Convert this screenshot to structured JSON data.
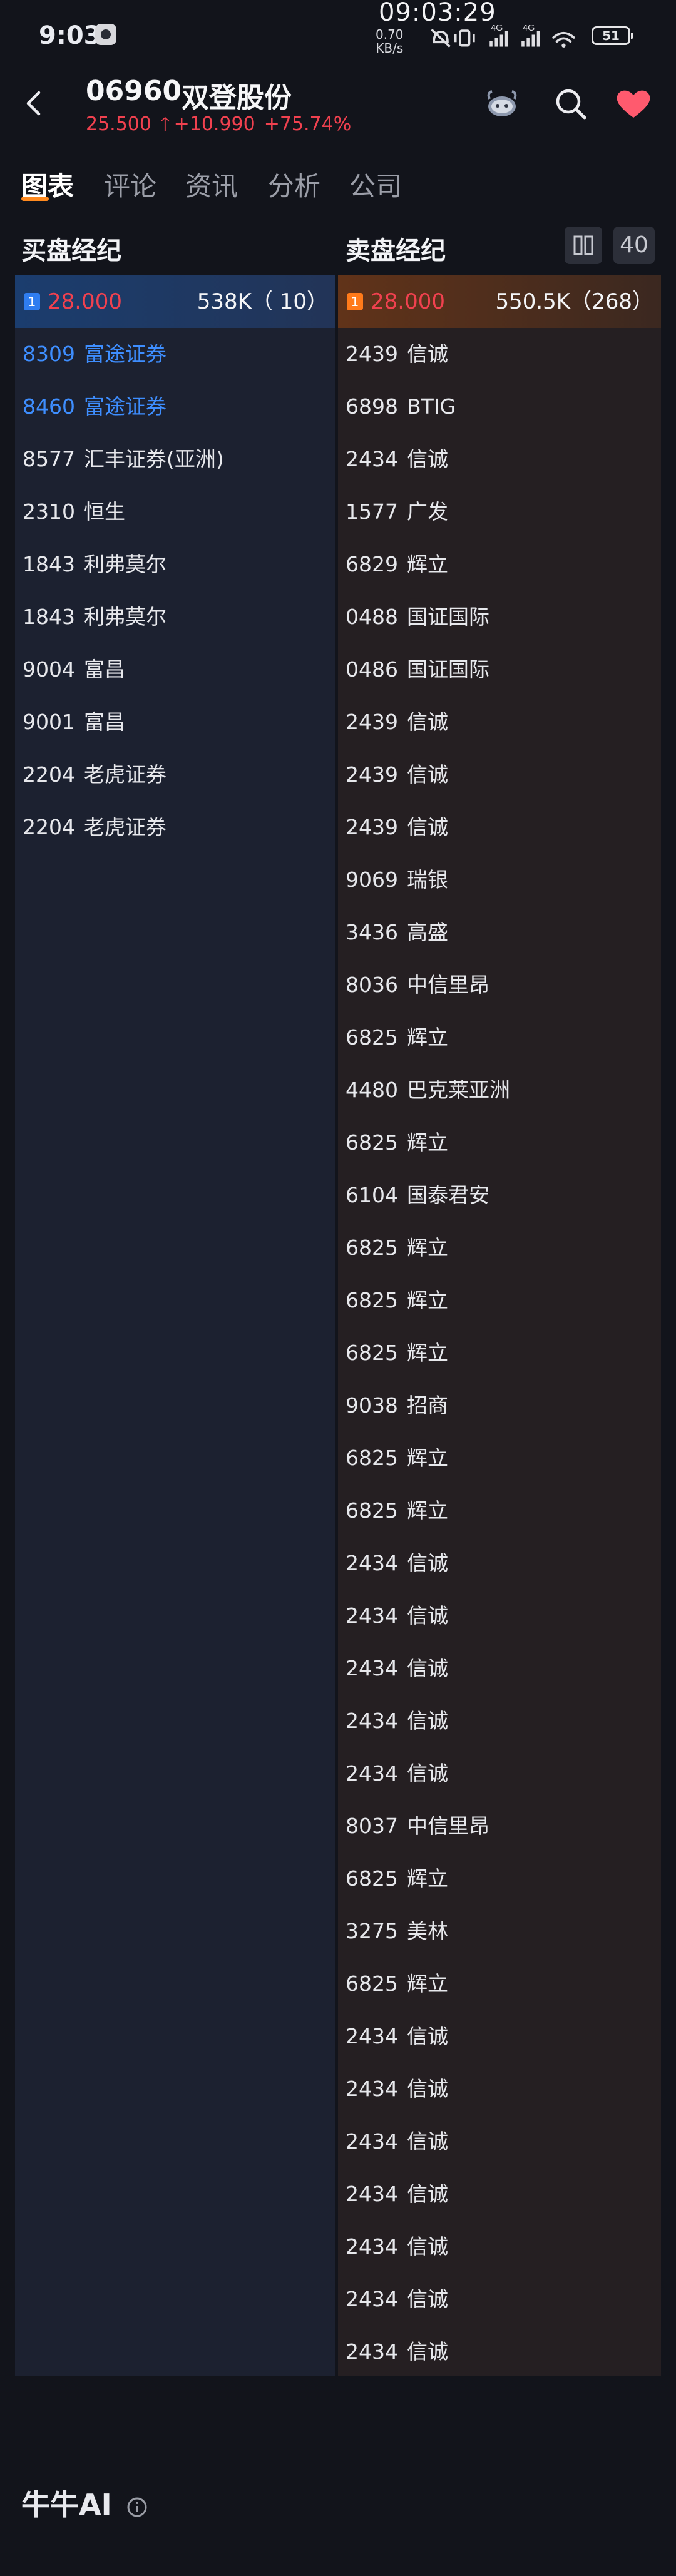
{
  "status_bar": {
    "time": "9:03",
    "clock_overlay": "09:03:29",
    "net_speed_value": "0.70",
    "net_speed_unit": "KB/s",
    "network_1": "4G",
    "network_2": "4G",
    "battery": "51"
  },
  "header": {
    "code": "06960",
    "name": "双登股份",
    "price": "25.500",
    "change": "+10.990",
    "change_pct": "+75.74%"
  },
  "tabs": [
    "图表",
    "评论",
    "资讯",
    "分析",
    "公司"
  ],
  "broker_queue": {
    "buy_title": "买盘经纪",
    "sell_title": "卖盘经纪",
    "depth": "40",
    "buy_top": {
      "level": "1",
      "price": "28.000",
      "volume": "538K（  10）"
    },
    "sell_top": {
      "level": "1",
      "price": "28.000",
      "volume": "550.5K（268）"
    },
    "buy_rows": [
      {
        "code": "8309",
        "name": "富途证券",
        "highlight": true
      },
      {
        "code": "8460",
        "name": "富途证券",
        "highlight": true
      },
      {
        "code": "8577",
        "name": "汇丰证券(亚洲)"
      },
      {
        "code": "2310",
        "name": "恒生"
      },
      {
        "code": "1843",
        "name": "利弗莫尔"
      },
      {
        "code": "1843",
        "name": "利弗莫尔"
      },
      {
        "code": "9004",
        "name": "富昌"
      },
      {
        "code": "9001",
        "name": "富昌"
      },
      {
        "code": "2204",
        "name": "老虎证券"
      },
      {
        "code": "2204",
        "name": "老虎证券"
      }
    ],
    "sell_rows": [
      {
        "code": "2439",
        "name": "信诚"
      },
      {
        "code": "6898",
        "name": "BTIG"
      },
      {
        "code": "2434",
        "name": "信诚"
      },
      {
        "code": "1577",
        "name": "广发"
      },
      {
        "code": "6829",
        "name": "辉立"
      },
      {
        "code": "0488",
        "name": "国证国际"
      },
      {
        "code": "0486",
        "name": "国证国际"
      },
      {
        "code": "2439",
        "name": "信诚"
      },
      {
        "code": "2439",
        "name": "信诚"
      },
      {
        "code": "2439",
        "name": "信诚"
      },
      {
        "code": "9069",
        "name": "瑞银"
      },
      {
        "code": "3436",
        "name": "高盛"
      },
      {
        "code": "8036",
        "name": "中信里昂"
      },
      {
        "code": "6825",
        "name": "辉立"
      },
      {
        "code": "4480",
        "name": "巴克莱亚洲"
      },
      {
        "code": "6825",
        "name": "辉立"
      },
      {
        "code": "6104",
        "name": "国泰君安"
      },
      {
        "code": "6825",
        "name": "辉立"
      },
      {
        "code": "6825",
        "name": "辉立"
      },
      {
        "code": "6825",
        "name": "辉立"
      },
      {
        "code": "9038",
        "name": "招商"
      },
      {
        "code": "6825",
        "name": "辉立"
      },
      {
        "code": "6825",
        "name": "辉立"
      },
      {
        "code": "2434",
        "name": "信诚"
      },
      {
        "code": "2434",
        "name": "信诚"
      },
      {
        "code": "2434",
        "name": "信诚"
      },
      {
        "code": "2434",
        "name": "信诚"
      },
      {
        "code": "2434",
        "name": "信诚"
      },
      {
        "code": "8037",
        "name": "中信里昂"
      },
      {
        "code": "6825",
        "name": "辉立"
      },
      {
        "code": "3275",
        "name": "美林"
      },
      {
        "code": "6825",
        "name": "辉立"
      },
      {
        "code": "2434",
        "name": "信诚"
      },
      {
        "code": "2434",
        "name": "信诚"
      },
      {
        "code": "2434",
        "name": "信诚"
      },
      {
        "code": "2434",
        "name": "信诚"
      },
      {
        "code": "2434",
        "name": "信诚"
      },
      {
        "code": "2434",
        "name": "信诚"
      },
      {
        "code": "2434",
        "name": "信诚"
      }
    ]
  },
  "ai_section": {
    "title": "牛牛AI"
  },
  "colors": {
    "background": "#12141b",
    "price_red": "#f0414f",
    "highlight_blue": "#3e8eff",
    "accent_orange": "#ff8a1f"
  },
  "icons": {
    "back": "chevron-left-icon",
    "mascot": "bull-mascot-icon",
    "search": "search-icon",
    "favorite": "heart-icon",
    "layout": "split-columns-icon",
    "info": "info-icon"
  }
}
